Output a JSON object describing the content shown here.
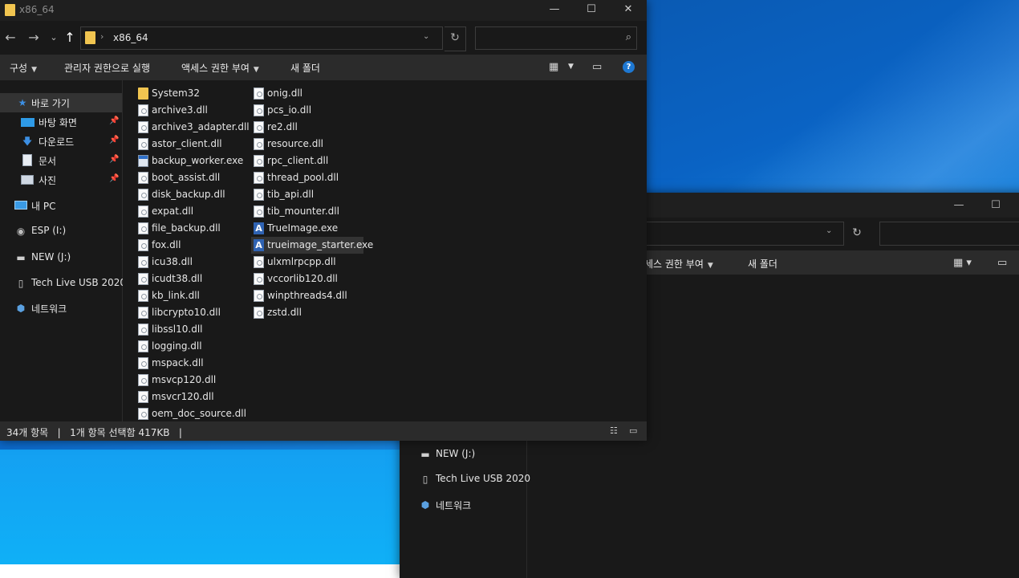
{
  "window": {
    "title": "x86_64",
    "minimize": "—",
    "maximize": "☐",
    "close": "✕"
  },
  "toolbar": {
    "back": "←",
    "forward": "→",
    "recent": "⌄",
    "up": "↑",
    "breadcrumb": "x86_64",
    "breadcrumb_sep": "›",
    "refresh": "↻",
    "search_placeholder": ""
  },
  "ribbon": {
    "organize": "구성",
    "run_as_admin": "관리자 권한으로 실행",
    "give_access": "액세스 권한 부여",
    "new_folder": "새 폴더"
  },
  "nav": {
    "items": [
      {
        "label": "바로 가기",
        "icon": "star-icon"
      },
      {
        "label": "바탕 화면",
        "icon": "desktop-icon",
        "pinned": true
      },
      {
        "label": "다운로드",
        "icon": "download-icon",
        "pinned": true
      },
      {
        "label": "문서",
        "icon": "document-icon",
        "pinned": true
      },
      {
        "label": "사진",
        "icon": "picture-icon",
        "pinned": true
      },
      {
        "label": "내 PC",
        "icon": "pc-icon"
      },
      {
        "label": "ESP (I:)",
        "icon": "drive-icon"
      },
      {
        "label": "NEW (J:)",
        "icon": "usb-drive-icon"
      },
      {
        "label": "Tech Live USB 2020",
        "icon": "disc-icon"
      },
      {
        "label": "네트워크",
        "icon": "network-icon"
      }
    ]
  },
  "files": {
    "column1": [
      {
        "name": "System32",
        "type": "folder"
      },
      {
        "name": "archive3.dll",
        "type": "dll"
      },
      {
        "name": "archive3_adapter.dll",
        "type": "dll"
      },
      {
        "name": "astor_client.dll",
        "type": "dll"
      },
      {
        "name": "backup_worker.exe",
        "type": "exe"
      },
      {
        "name": "boot_assist.dll",
        "type": "dll"
      },
      {
        "name": "disk_backup.dll",
        "type": "dll"
      },
      {
        "name": "expat.dll",
        "type": "dll"
      },
      {
        "name": "file_backup.dll",
        "type": "dll"
      },
      {
        "name": "fox.dll",
        "type": "dll"
      },
      {
        "name": "icu38.dll",
        "type": "dll"
      },
      {
        "name": "icudt38.dll",
        "type": "dll"
      },
      {
        "name": "kb_link.dll",
        "type": "dll"
      },
      {
        "name": "libcrypto10.dll",
        "type": "dll"
      },
      {
        "name": "libssl10.dll",
        "type": "dll"
      },
      {
        "name": "logging.dll",
        "type": "dll"
      },
      {
        "name": "mspack.dll",
        "type": "dll"
      },
      {
        "name": "msvcp120.dll",
        "type": "dll"
      },
      {
        "name": "msvcr120.dll",
        "type": "dll"
      },
      {
        "name": "oem_doc_source.dll",
        "type": "dll"
      }
    ],
    "column2": [
      {
        "name": "onig.dll",
        "type": "dll"
      },
      {
        "name": "pcs_io.dll",
        "type": "dll"
      },
      {
        "name": "re2.dll",
        "type": "dll"
      },
      {
        "name": "resource.dll",
        "type": "dll"
      },
      {
        "name": "rpc_client.dll",
        "type": "dll"
      },
      {
        "name": "thread_pool.dll",
        "type": "dll"
      },
      {
        "name": "tib_api.dll",
        "type": "dll"
      },
      {
        "name": "tib_mounter.dll",
        "type": "dll"
      },
      {
        "name": "TrueImage.exe",
        "type": "trueimage"
      },
      {
        "name": "trueimage_starter.exe",
        "type": "trueimage",
        "selected": true
      },
      {
        "name": "ulxmlrpcpp.dll",
        "type": "dll"
      },
      {
        "name": "vccorlib120.dll",
        "type": "dll"
      },
      {
        "name": "winpthreads4.dll",
        "type": "dll"
      },
      {
        "name": "zstd.dll",
        "type": "dll"
      }
    ]
  },
  "status": {
    "text": "34개 항목   |   1개 항목 선택함 417KB   |"
  },
  "back_window": {
    "give_access": "세스 권한 부여",
    "new_folder": "새 폴더",
    "nav": [
      {
        "label": "NEW (J:)"
      },
      {
        "label": "Tech Live USB 2020"
      },
      {
        "label": "네트워크"
      }
    ]
  },
  "colors": {
    "accent": "#1e78d2",
    "window_bg": "#191919",
    "ribbon_bg": "#2b2b2b",
    "selection": "#333333",
    "folder": "#f1c550"
  }
}
